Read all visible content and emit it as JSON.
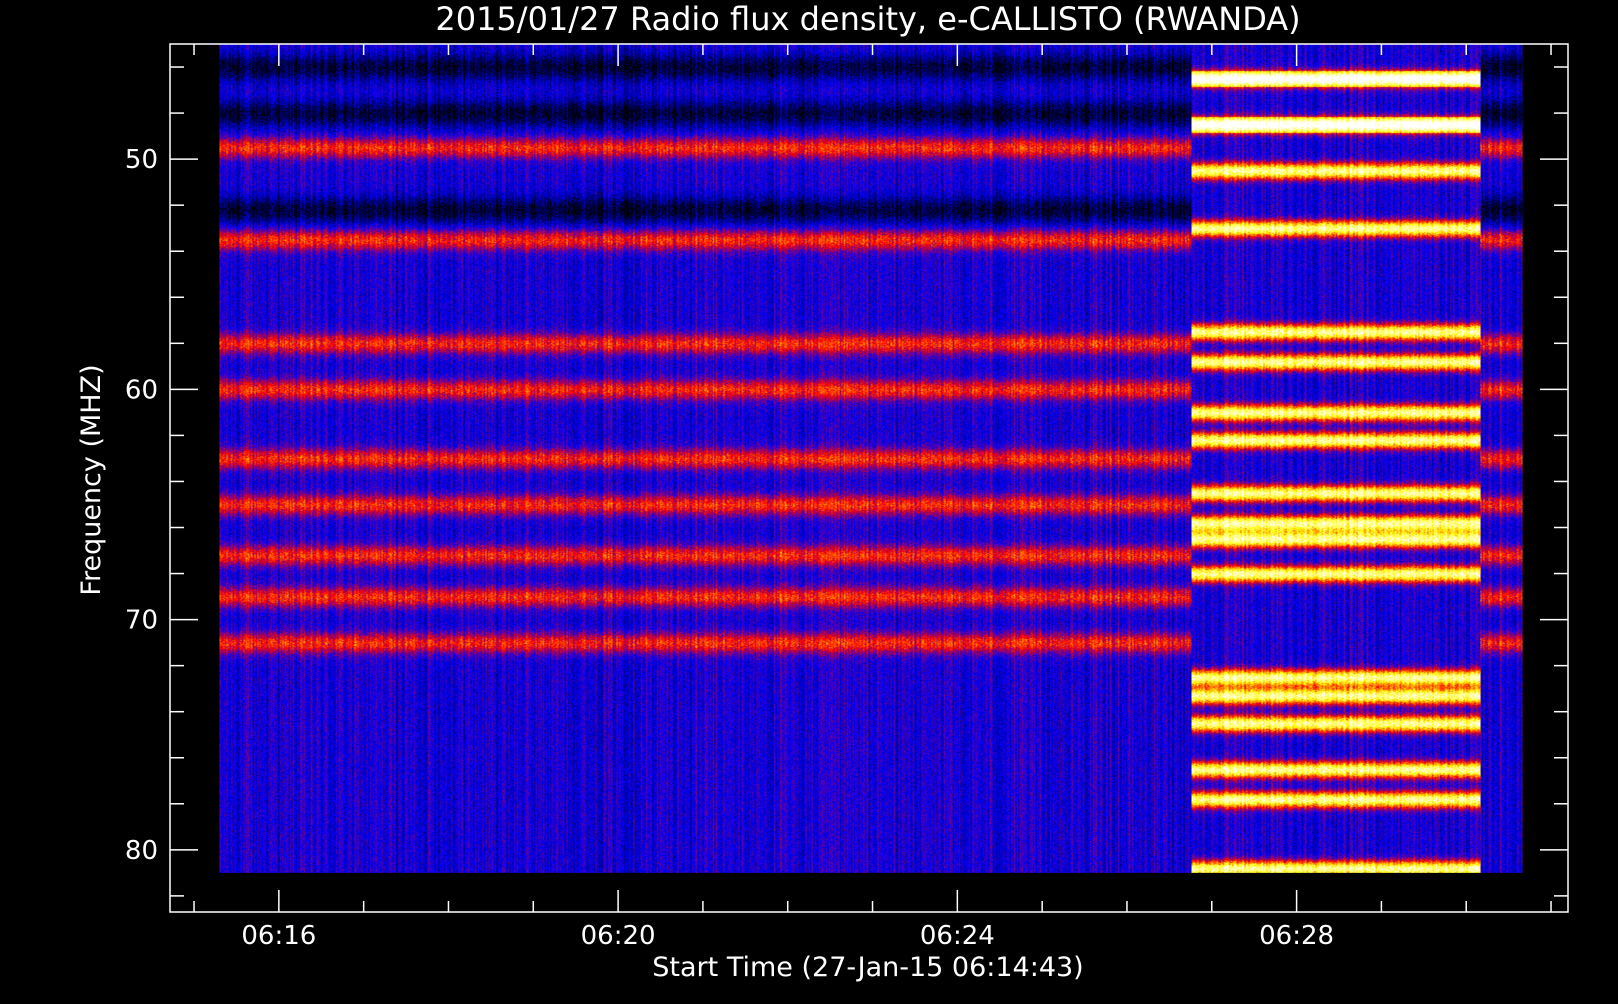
{
  "chart_data": {
    "type": "heatmap",
    "title": "2015/01/27  Radio flux density, e-CALLISTO (RWANDA)",
    "xlabel": "Start Time (27-Jan-15 06:14:43)",
    "ylabel": "Frequency (MHZ)",
    "x_axis": {
      "unit": "UT time",
      "range": [
        "06:14:43",
        "06:31:12"
      ],
      "data_range": [
        "06:15:18",
        "06:30:40"
      ],
      "tick_labels": [
        "06:16",
        "06:20",
        "06:24",
        "06:28"
      ],
      "tick_minutes": [
        16,
        20,
        24,
        28
      ]
    },
    "y_axis": {
      "unit": "MHz",
      "range": [
        45.0,
        82.7
      ],
      "data_range": [
        45.0,
        81.0
      ],
      "inverted": true,
      "tick_labels": [
        "50",
        "60",
        "70",
        "80"
      ],
      "tick_values": [
        50,
        60,
        70,
        80
      ]
    },
    "colormap": [
      "#000000",
      "#0000ff",
      "#ff0000",
      "#ffff00",
      "#ffffff"
    ],
    "burst": {
      "start": "06:26:45",
      "end": "06:30:10",
      "bright_bands_mhz": [
        46.5,
        48.5,
        50.5,
        53.0,
        57.5,
        58.8,
        61.0,
        62.2,
        64.5,
        65.8,
        66.5,
        68.0,
        72.5,
        73.3,
        74.5,
        76.5,
        77.8,
        80.8
      ]
    },
    "pre_burst": {
      "red_bands_mhz": [
        49.5,
        53.5,
        58.0,
        60.0,
        63.0,
        65.0,
        67.2,
        69.0,
        71.0
      ],
      "dark_bands_mhz": [
        46.0,
        48.0,
        52.2
      ]
    },
    "grid": false,
    "legend": "none"
  }
}
